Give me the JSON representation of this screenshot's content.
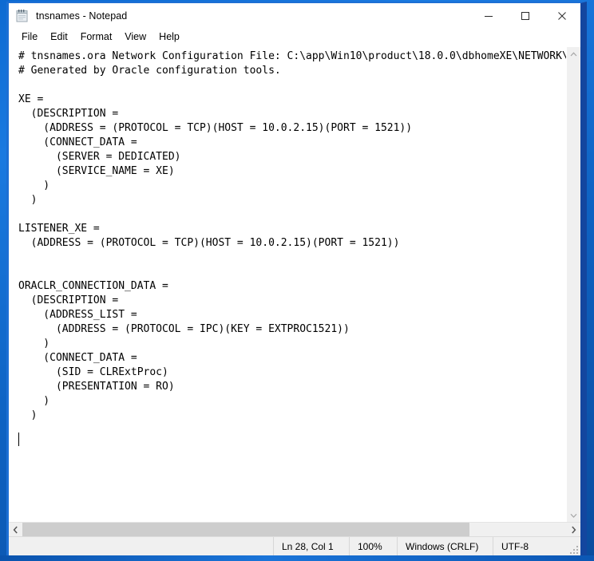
{
  "window": {
    "title": "tnsnames - Notepad",
    "app_icon": "notepad-icon",
    "controls": {
      "minimize": "minimize-icon",
      "maximize": "maximize-icon",
      "close": "close-icon"
    }
  },
  "menubar": {
    "items": [
      {
        "label": "File"
      },
      {
        "label": "Edit"
      },
      {
        "label": "Format"
      },
      {
        "label": "View"
      },
      {
        "label": "Help"
      }
    ]
  },
  "editor": {
    "text": "# tnsnames.ora Network Configuration File: C:\\app\\Win10\\product\\18.0.0\\dbhomeXE\\NETWORK\\ADMIN\\tnsnames.ora\n# Generated by Oracle configuration tools.\n\nXE =\n  (DESCRIPTION =\n    (ADDRESS = (PROTOCOL = TCP)(HOST = 10.0.2.15)(PORT = 1521))\n    (CONNECT_DATA =\n      (SERVER = DEDICATED)\n      (SERVICE_NAME = XE)\n    )\n  )\n\nLISTENER_XE =\n  (ADDRESS = (PROTOCOL = TCP)(HOST = 10.0.2.15)(PORT = 1521))\n\n\nORACLR_CONNECTION_DATA =\n  (DESCRIPTION =\n    (ADDRESS_LIST =\n      (ADDRESS = (PROTOCOL = IPC)(KEY = EXTPROC1521))\n    )\n    (CONNECT_DATA =\n      (SID = CLRExtProc)\n      (PRESENTATION = RO)\n    )\n  )\n",
    "caret_line": 28,
    "caret_column": 1,
    "text_color": "#000000",
    "background_color": "#ffffff"
  },
  "scrollbars": {
    "vertical": {
      "up_arrow": "chevron-up-icon",
      "down_arrow": "chevron-down-icon"
    },
    "horizontal": {
      "left_arrow": "chevron-left-icon",
      "right_arrow": "chevron-right-icon"
    }
  },
  "statusbar": {
    "position": "Ln 28, Col 1",
    "zoom": "100%",
    "line_ending": "Windows (CRLF)",
    "encoding": "UTF-8",
    "resize_grip": "resize-grip-icon"
  },
  "colors": {
    "desktop_blue": "#0e62c2",
    "window_border_blue": "#13469f",
    "titlebar_bg": "#ffffff",
    "statusbar_bg": "#f0f0f0",
    "scroll_thumb": "#cdcdcd"
  }
}
